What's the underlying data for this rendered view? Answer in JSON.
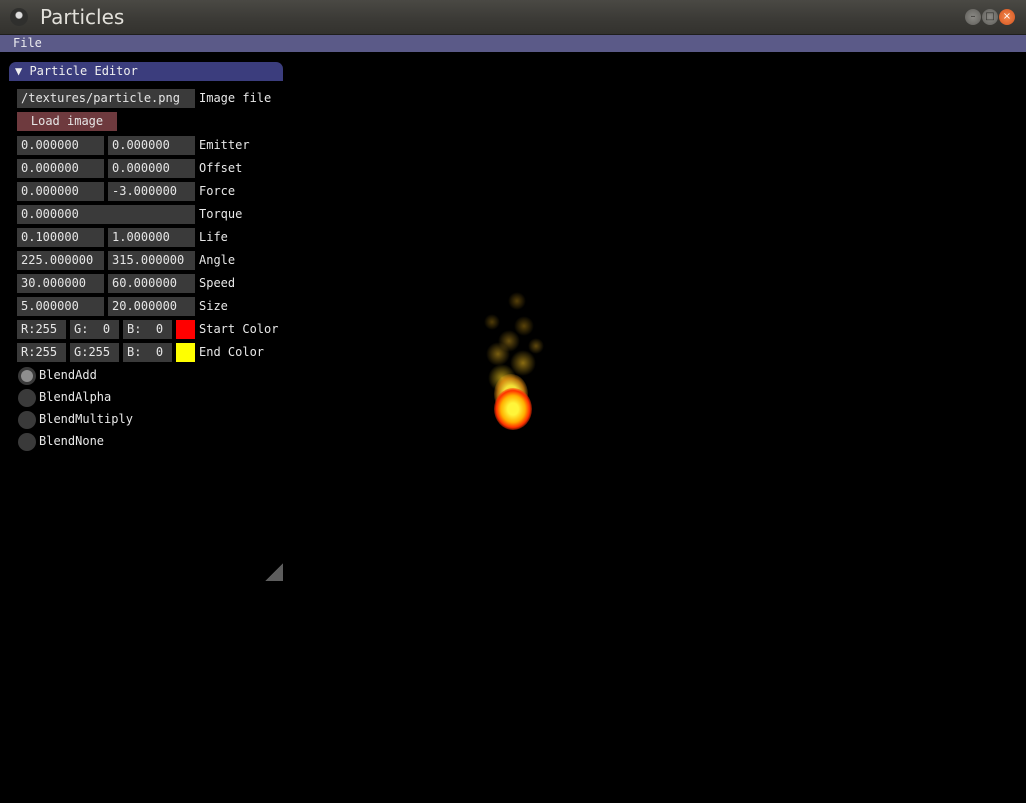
{
  "window": {
    "title": "Particles",
    "controls": [
      "minimize-icon",
      "maximize-icon",
      "close-icon"
    ]
  },
  "menubar": {
    "file_label": "File"
  },
  "editor": {
    "title": "▼ Particle Editor",
    "image_file": {
      "value": "/textures/particle.png",
      "label": "Image file"
    },
    "load_button": "Load image",
    "rows": {
      "emitter": {
        "a": "0.000000",
        "b": "0.000000",
        "label": "Emitter"
      },
      "offset": {
        "a": "0.000000",
        "b": "0.000000",
        "label": "Offset"
      },
      "force": {
        "a": "0.000000",
        "b": "-3.000000",
        "label": "Force"
      },
      "torque": {
        "a": "0.000000",
        "label": "Torque"
      },
      "life": {
        "a": "0.100000",
        "b": "1.000000",
        "label": "Life"
      },
      "angle": {
        "a": "225.000000",
        "b": "315.000000",
        "label": "Angle"
      },
      "speed": {
        "a": "30.000000",
        "b": "60.000000",
        "label": "Speed"
      },
      "size": {
        "a": "5.000000",
        "b": "20.000000",
        "label": "Size"
      }
    },
    "start_color": {
      "r": "R:255",
      "g": "G:  0",
      "b": "B:  0",
      "swatch": "#ff0000",
      "label": "Start Color"
    },
    "end_color": {
      "r": "R:255",
      "g": "G:255",
      "b": "B:  0",
      "swatch": "#ffff00",
      "label": "End Color"
    },
    "blend_modes": [
      {
        "label": "BlendAdd",
        "selected": true
      },
      {
        "label": "BlendAlpha",
        "selected": false
      },
      {
        "label": "BlendMultiply",
        "selected": false
      },
      {
        "label": "BlendNone",
        "selected": false
      }
    ]
  }
}
